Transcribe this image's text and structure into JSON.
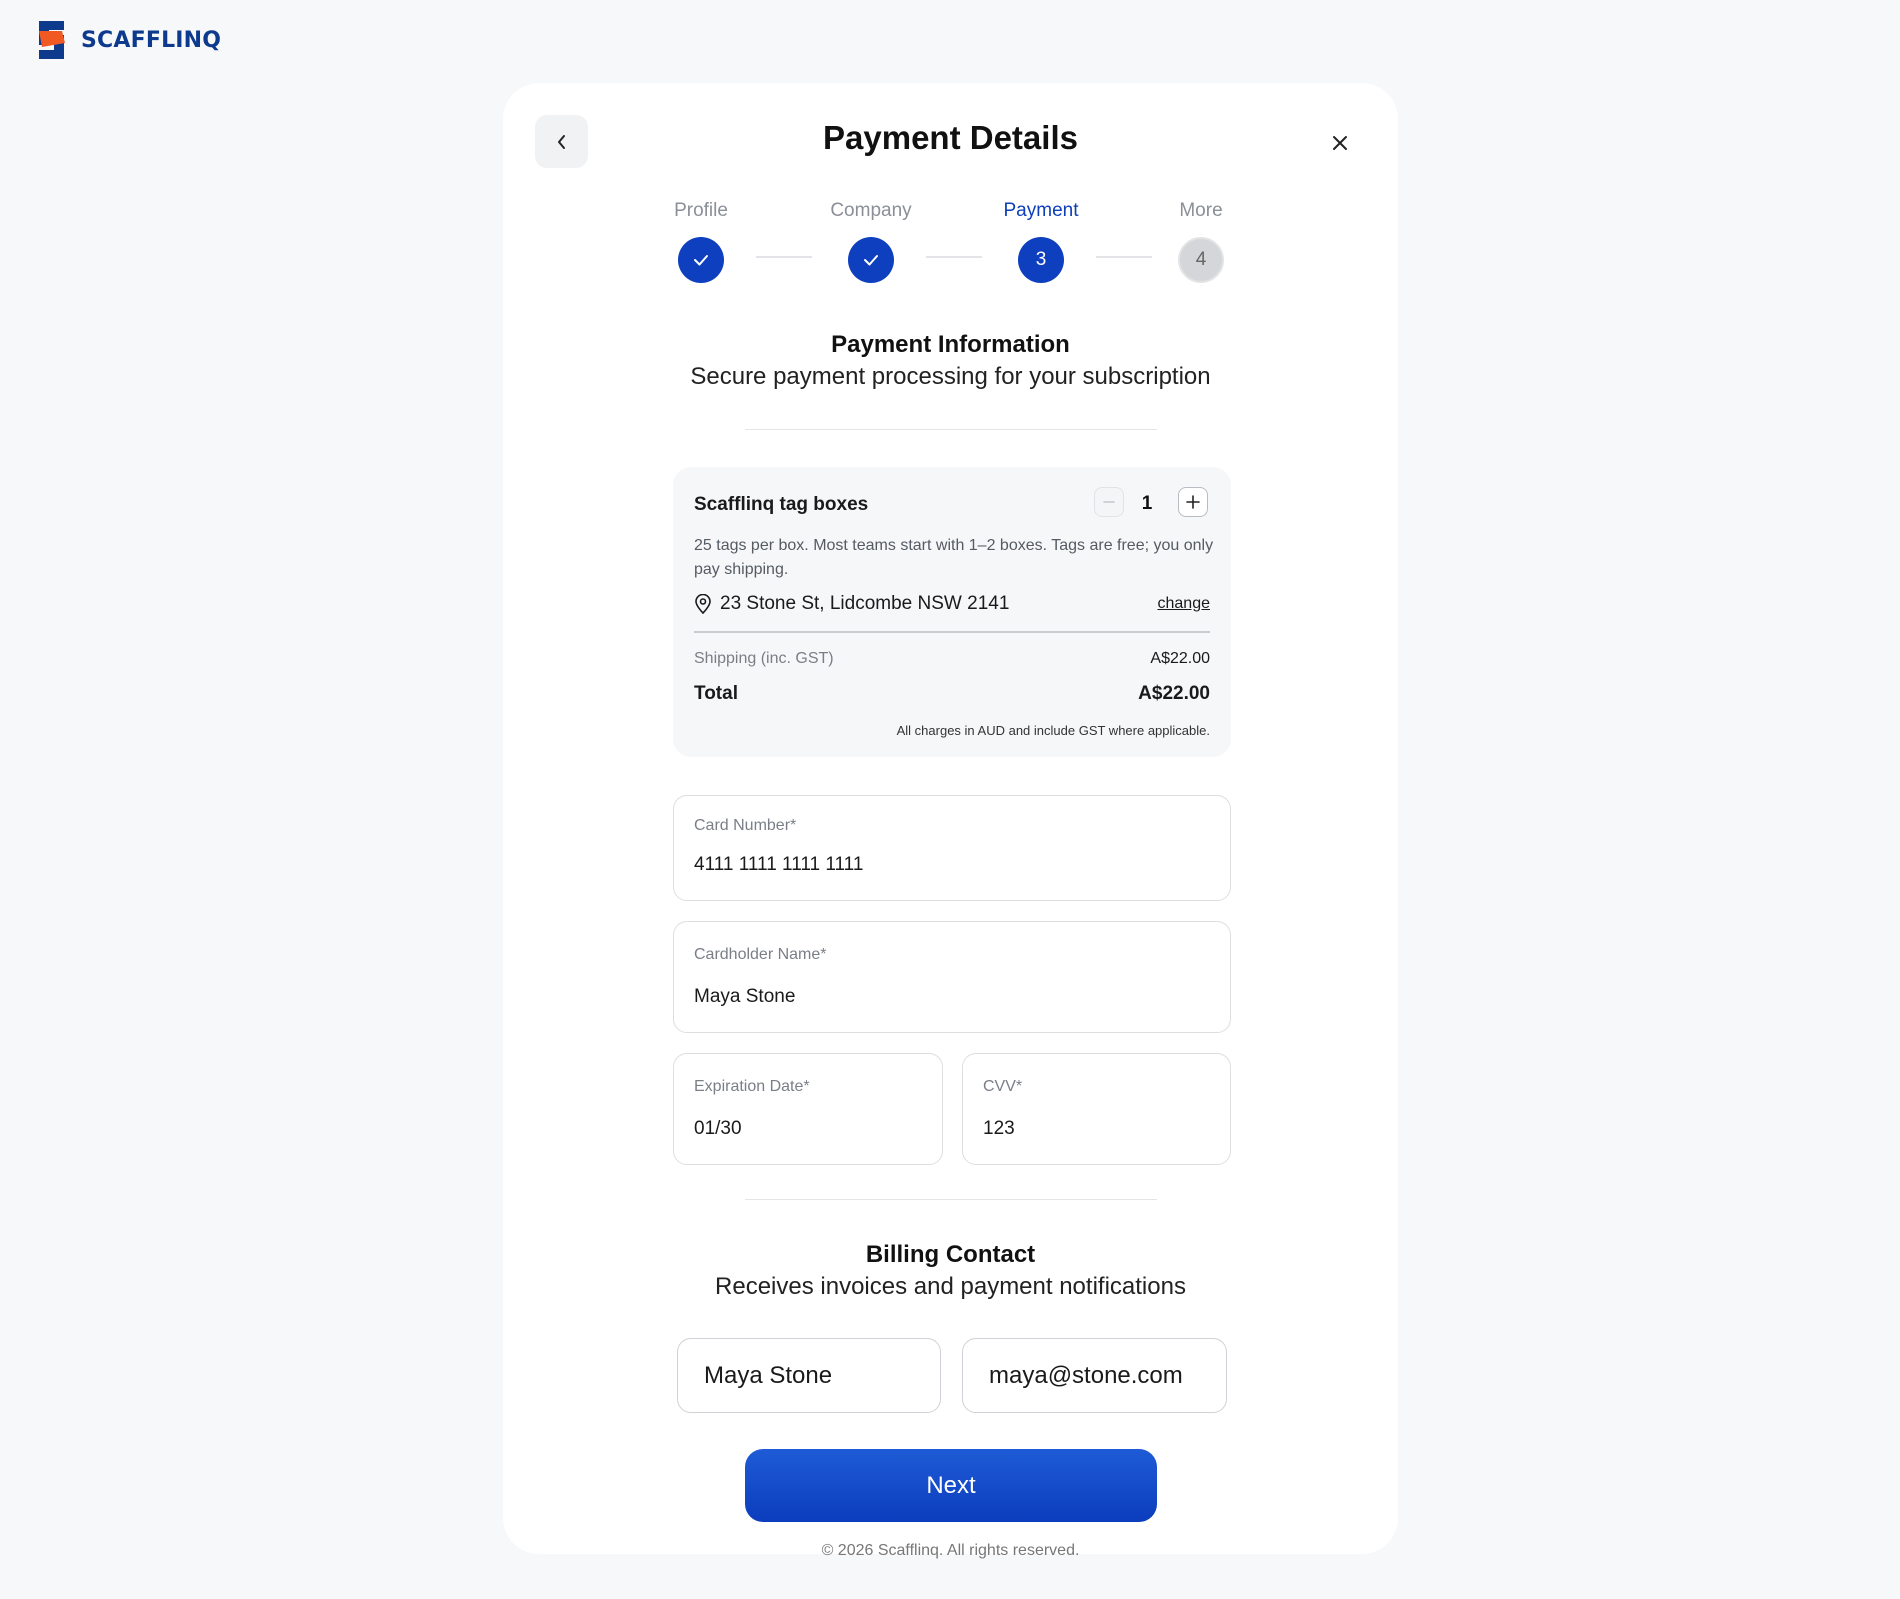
{
  "brand": {
    "name": "SCAFFLINQ",
    "primary": "#0d3fbf",
    "accent": "#f05a22",
    "dark": "#0d3a8c"
  },
  "header": {
    "title": "Payment Details",
    "back_icon": "chevron-left-icon",
    "close_icon": "close-icon"
  },
  "stepper": {
    "steps": [
      {
        "label": "Profile",
        "state": "complete",
        "marker": ""
      },
      {
        "label": "Company",
        "state": "complete",
        "marker": ""
      },
      {
        "label": "Payment",
        "state": "active",
        "marker": "3"
      },
      {
        "label": "More",
        "state": "pending",
        "marker": "4"
      }
    ]
  },
  "payment_section": {
    "title": "Payment Information",
    "subtitle": "Secure payment processing for your subscription"
  },
  "order": {
    "product": "Scafflinq tag boxes",
    "quantity": "1",
    "description": "25 tags per box. Most teams start with 1–2 boxes. Tags are free; you only pay shipping.",
    "address": "23 Stone St, Lidcombe NSW 2141",
    "change_label": "change",
    "shipping_label": "Shipping (inc. GST)",
    "shipping_value": "A$22.00",
    "total_label": "Total",
    "total_value": "A$22.00",
    "note": "All charges in AUD and include GST where applicable."
  },
  "card": {
    "number_label": "Card Number*",
    "number_value": "4111 1111 1111 1111",
    "name_label": "Cardholder Name*",
    "name_value": "Maya Stone",
    "expiry_label": "Expiration Date*",
    "expiry_value": "01/30",
    "cvv_label": "CVV*",
    "cvv_value": "123"
  },
  "billing": {
    "title": "Billing Contact",
    "subtitle": "Receives invoices and payment notifications",
    "name_value": "Maya Stone",
    "email_value": "maya@stone.com"
  },
  "actions": {
    "next_label": "Next"
  },
  "footer": {
    "copyright": "© 2026 Scafflinq. All rights reserved."
  }
}
